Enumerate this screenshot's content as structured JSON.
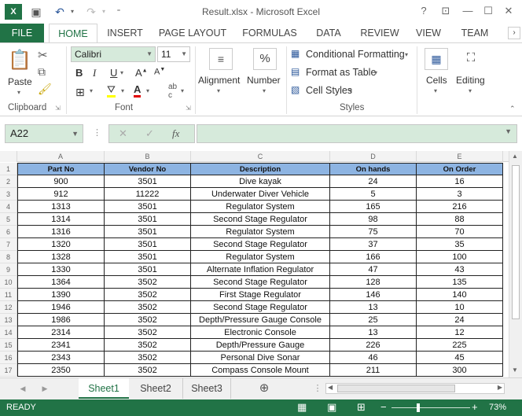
{
  "titlebar": {
    "title": "Result.xlsx - Microsoft Excel",
    "help": "?",
    "minimize": "—",
    "restore": "☐",
    "close": "✕"
  },
  "ribbon_tabs": [
    "FILE",
    "HOME",
    "INSERT",
    "PAGE LAYOUT",
    "FORMULAS",
    "DATA",
    "REVIEW",
    "VIEW",
    "TEAM"
  ],
  "clipboard": {
    "paste": "Paste",
    "label": "Clipboard"
  },
  "font": {
    "name": "Calibri",
    "size": "11",
    "label": "Font",
    "bold": "B",
    "italic": "I",
    "underline": "U"
  },
  "alignment": {
    "label": "Alignment"
  },
  "number": {
    "label": "Number",
    "icon": "%"
  },
  "styles": {
    "cond": "Conditional Formatting",
    "table": "Format as Table",
    "cell": "Cell Styles",
    "label": "Styles"
  },
  "cells": {
    "label": "Cells"
  },
  "editing": {
    "label": "Editing"
  },
  "formula_bar": {
    "name_box": "A22",
    "fx": "fx"
  },
  "columns": [
    "A",
    "B",
    "C",
    "D",
    "E"
  ],
  "table": {
    "headers": [
      "Part No",
      "Vendor No",
      "Description",
      "On hands",
      "On Order"
    ],
    "rows": [
      [
        "900",
        "3501",
        "Dive kayak",
        "24",
        "16"
      ],
      [
        "912",
        "11222",
        "Underwater Diver Vehicle",
        "5",
        "3"
      ],
      [
        "1313",
        "3501",
        "Regulator System",
        "165",
        "216"
      ],
      [
        "1314",
        "3501",
        "Second Stage Regulator",
        "98",
        "88"
      ],
      [
        "1316",
        "3501",
        "Regulator System",
        "75",
        "70"
      ],
      [
        "1320",
        "3501",
        "Second Stage Regulator",
        "37",
        "35"
      ],
      [
        "1328",
        "3501",
        "Regulator System",
        "166",
        "100"
      ],
      [
        "1330",
        "3501",
        "Alternate Inflation Regulator",
        "47",
        "43"
      ],
      [
        "1364",
        "3502",
        "Second Stage Regulator",
        "128",
        "135"
      ],
      [
        "1390",
        "3502",
        "First Stage Regulator",
        "146",
        "140"
      ],
      [
        "1946",
        "3502",
        "Second Stage Regulator",
        "13",
        "10"
      ],
      [
        "1986",
        "3502",
        "Depth/Pressure Gauge Console",
        "25",
        "24"
      ],
      [
        "2314",
        "3502",
        "Electronic Console",
        "13",
        "12"
      ],
      [
        "2341",
        "3502",
        "Depth/Pressure Gauge",
        "226",
        "225"
      ],
      [
        "2343",
        "3502",
        "Personal Dive Sonar",
        "46",
        "45"
      ],
      [
        "2350",
        "3502",
        "Compass Console Mount",
        "211",
        "300"
      ]
    ]
  },
  "row_numbers": [
    "1",
    "2",
    "3",
    "4",
    "5",
    "6",
    "7",
    "8",
    "9",
    "10",
    "11",
    "12",
    "13",
    "14",
    "15",
    "16",
    "17"
  ],
  "sheets": [
    "Sheet1",
    "Sheet2",
    "Sheet3"
  ],
  "status": {
    "ready": "READY",
    "zoom": "73%"
  },
  "colors": {
    "excel_green": "#217346",
    "header_fill": "#8db4e2",
    "formula_fill": "#d6eadb"
  }
}
